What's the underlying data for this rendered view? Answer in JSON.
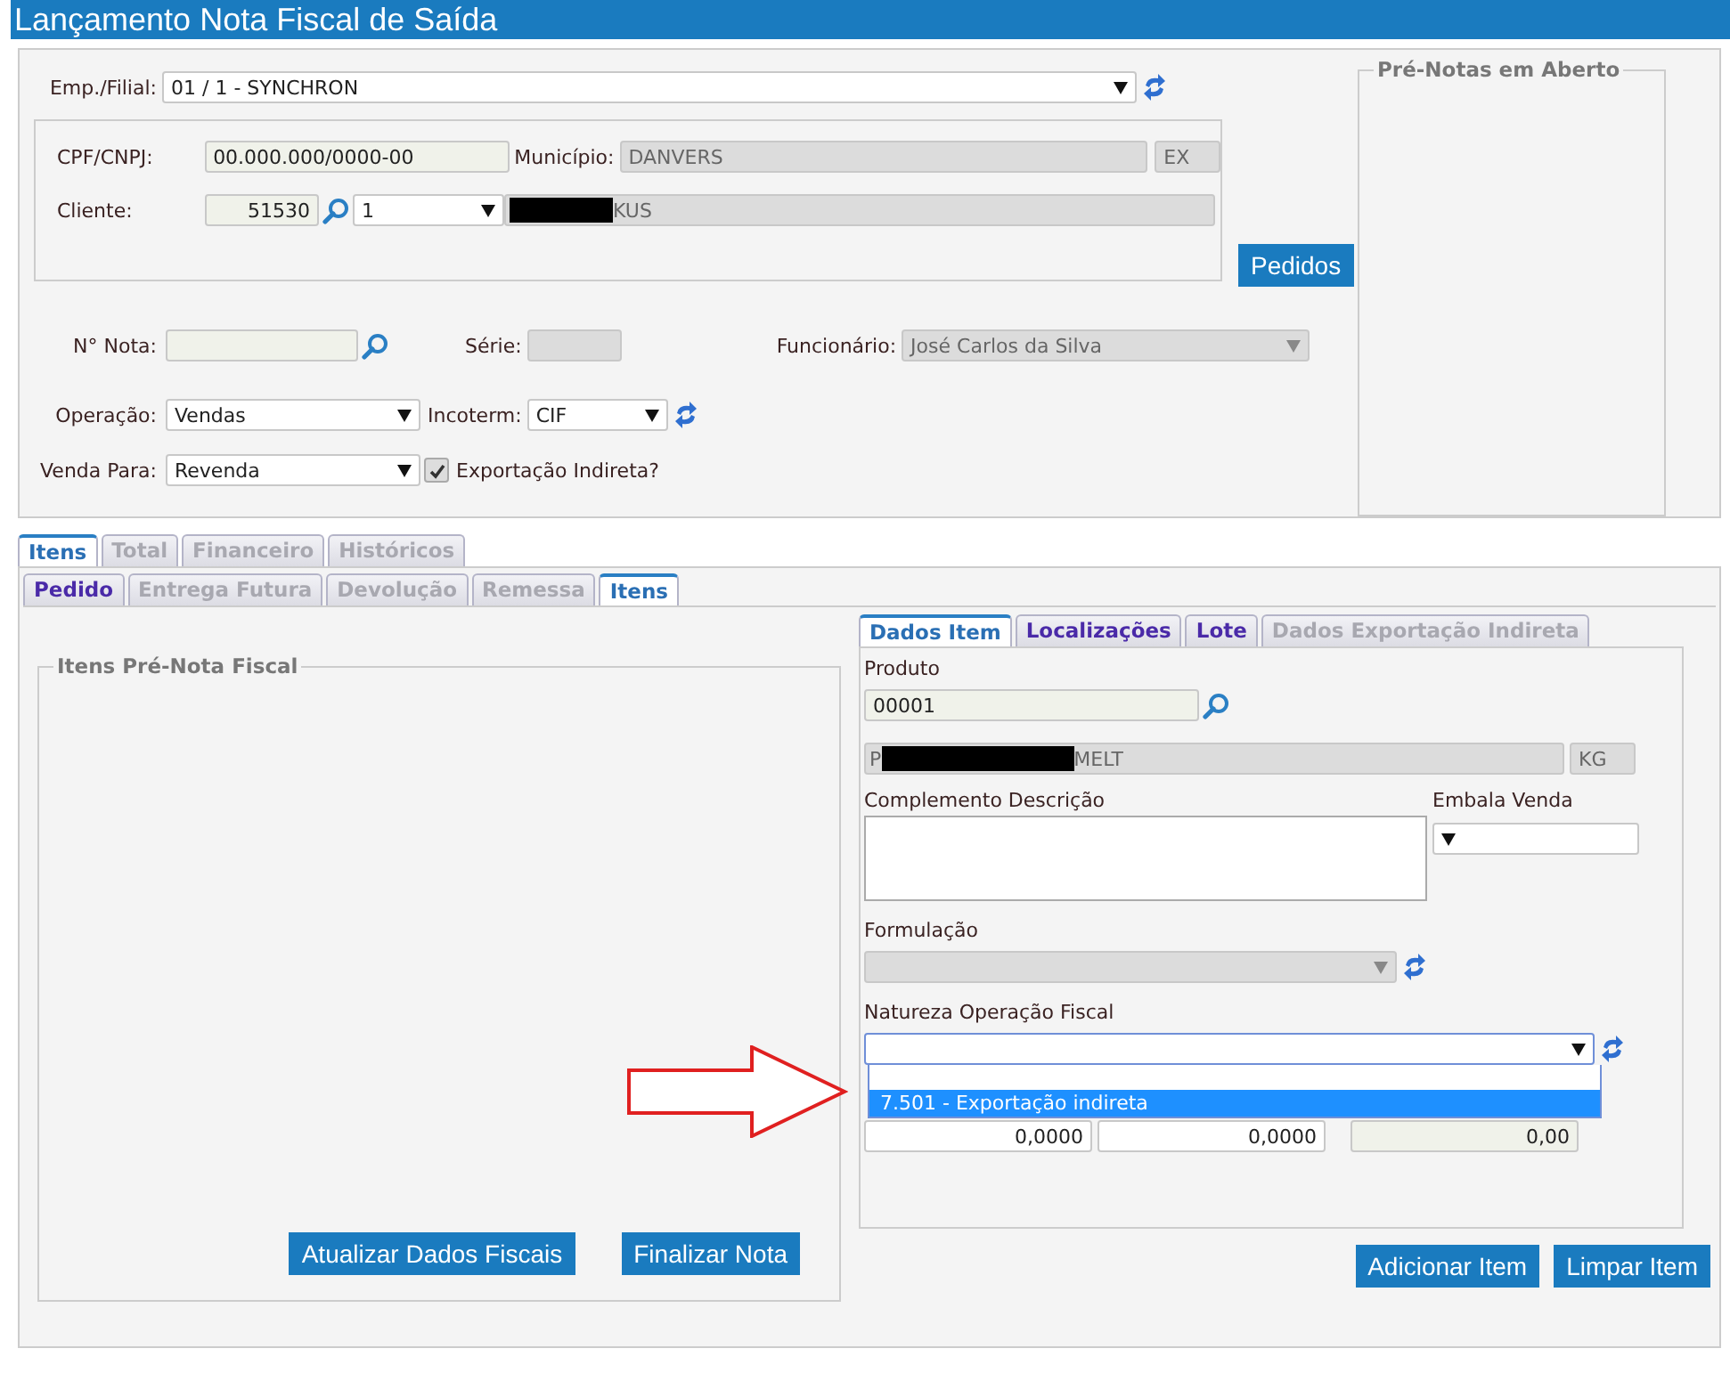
{
  "title": "Lançamento Nota Fiscal de Saída",
  "header": {
    "empresa": {
      "label": "Emp./Filial:",
      "value": "01 / 1 - SYNCHRON"
    },
    "cpf": {
      "label": "CPF/CNPJ:",
      "value": "00.000.000/0000-00"
    },
    "municipio": {
      "label": "Município:",
      "value": "DANVERS",
      "uf": "EX"
    },
    "cliente": {
      "label": "Cliente:",
      "code": "51530",
      "store": "1",
      "name_tail": "KUS"
    },
    "pedidos_button": "Pedidos",
    "nota": {
      "label": "N° Nota:"
    },
    "serie": {
      "label": "Série:"
    },
    "funcionario": {
      "label": "Funcionário:",
      "value": "José Carlos da Silva",
      "disabled": true
    },
    "operacao": {
      "label": "Operação:",
      "value": "Vendas"
    },
    "incoterm": {
      "label": "Incoterm:",
      "value": "CIF"
    },
    "venda_para": {
      "label": "Venda Para:",
      "value": "Revenda"
    },
    "exportacao": {
      "label": "Exportação Indireta?",
      "checked": true
    }
  },
  "pre_notas": {
    "legend": "Pré-Notas em Aberto"
  },
  "tabs": [
    {
      "label": "Itens",
      "selected": true,
      "disabled": false
    },
    {
      "label": "Total",
      "selected": false,
      "disabled": true
    },
    {
      "label": "Financeiro",
      "selected": false,
      "disabled": true
    },
    {
      "label": "Históricos",
      "selected": false,
      "disabled": true
    }
  ],
  "sub_tabs": [
    {
      "label": "Pedido",
      "selected": false,
      "disabled": false
    },
    {
      "label": "Entrega Futura",
      "selected": false,
      "disabled": true
    },
    {
      "label": "Devolução",
      "selected": false,
      "disabled": true
    },
    {
      "label": "Remessa",
      "selected": false,
      "disabled": true
    },
    {
      "label": "Itens",
      "selected": true,
      "disabled": false
    }
  ],
  "itens_fieldset": {
    "legend": "Itens Pré-Nota Fiscal",
    "buttons": [
      "Atualizar Dados Fiscais",
      "Finalizar Nota"
    ]
  },
  "item_tabs": [
    {
      "label": "Dados Item",
      "selected": true,
      "disabled": false
    },
    {
      "label": "Localizações",
      "selected": false,
      "disabled": false
    },
    {
      "label": "Lote",
      "selected": false,
      "disabled": false
    },
    {
      "label": "Dados Exportação Indireta",
      "selected": false,
      "disabled": true
    }
  ],
  "item": {
    "produto_label": "Produto",
    "produto_code": "00001",
    "desc_head": "P",
    "desc_tail": "MELT",
    "unit": "KG",
    "complemento_label": "Complemento Descrição",
    "embala_label": "Embala Venda",
    "formulacao_label": "Formulação",
    "natureza_label": "Natureza Operação Fiscal",
    "natureza_options": [
      {
        "label": "7.501 - Exportação indireta",
        "selected": true
      }
    ],
    "values": [
      {
        "value": "0,0000",
        "kind": "input"
      },
      {
        "value": "0,0000",
        "kind": "input"
      },
      {
        "value": "0,00",
        "kind": "readonly"
      }
    ]
  },
  "item_buttons": [
    "Adicionar Item",
    "Limpar Item"
  ]
}
